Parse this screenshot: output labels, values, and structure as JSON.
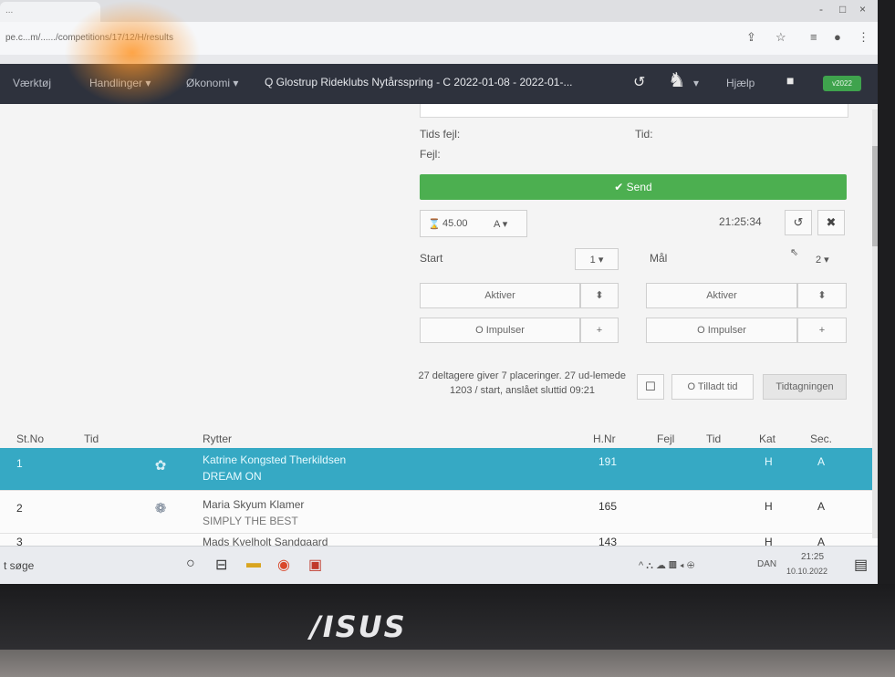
{
  "browser": {
    "tab_title": "...",
    "url": "pe.c...m/....../competitions/17/12/H/results",
    "window_controls": [
      "-",
      "□",
      "×"
    ],
    "omnibox_icons": [
      "share-icon",
      "star-icon",
      "list-icon",
      "profile-icon",
      "menu-icon"
    ]
  },
  "nav": {
    "item1": "Værktøj",
    "item2": "Handlinger ▾",
    "item3": "Økonomi ▾",
    "search_text": "Q Glostrup Rideklubs Nytårsspring - C 2022-01-08 - 2022-01-...",
    "help": "Hjælp",
    "badge": "v2022"
  },
  "form": {
    "tids_fejl_label": "Tids fejl:",
    "fejl_label": "Fejl:",
    "tid_label": "Tid:",
    "send_label": "✔ Send",
    "time_setting": "45.00",
    "type_select": "A ▾",
    "clock": "21:25:34",
    "start_label": "Start",
    "start_select": "1 ▾",
    "mal_label": "Mål",
    "mal_select": "2 ▾",
    "activate_label": "Aktiver",
    "impulse_label": "O Impulser",
    "status_line1": "27 deltagere giver 7 placeringer. 27 ud-lemede",
    "status_line2": "1203 / start, anslået sluttid 09:21",
    "allowed_time": "O Tilladt tid",
    "tidtagning": "Tidtagningen"
  },
  "table": {
    "headers": {
      "stno": "St.No",
      "tid": "Tid",
      "rytter": "Rytter",
      "hnr": "H.Nr",
      "fejl": "Fejl",
      "tid2": "Tid",
      "kat": "Kat",
      "sec": "Sec."
    },
    "rows": [
      {
        "stno": "1",
        "rider": "Katrine Kongsted Therkildsen",
        "horse": "DREAM ON",
        "hnr": "191",
        "kat": "H",
        "sec": "A"
      },
      {
        "stno": "2",
        "rider": "Maria Skyum Klamer",
        "horse": "SIMPLY THE BEST",
        "hnr": "165",
        "kat": "H",
        "sec": "A"
      },
      {
        "stno": "3",
        "rider": "Mads Kvelholt Sandgaard",
        "horse": "",
        "hnr": "143",
        "kat": "H",
        "sec": "A"
      }
    ]
  },
  "taskbar": {
    "search": "t søge",
    "time": "21:25",
    "date": "10.10.2022",
    "lang": "DAN"
  },
  "laptop": {
    "brand": "/ISUS"
  }
}
